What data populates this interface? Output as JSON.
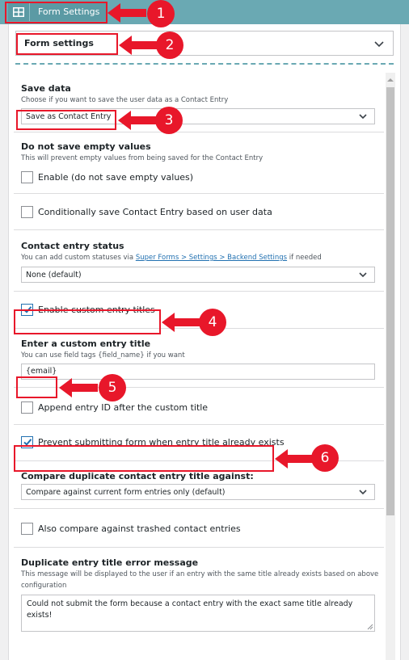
{
  "topbar": {
    "title": "Form Settings",
    "icon": "grid-icon"
  },
  "section_select": {
    "value": "Form settings"
  },
  "save_data": {
    "title": "Save data",
    "desc": "Choose if you want to save the user data as a Contact Entry",
    "value": "Save as Contact Entry"
  },
  "empty_values": {
    "title": "Do not save empty values",
    "desc": "This will prevent empty values from being saved for the Contact Entry",
    "checkbox_label": "Enable (do not save empty values)",
    "checked": false
  },
  "conditional_save": {
    "checkbox_label": "Conditionally save Contact Entry based on user data",
    "checked": false
  },
  "contact_status": {
    "title": "Contact entry status",
    "desc_before": "You can add custom statuses via ",
    "desc_link": "Super Forms > Settings > Backend Settings",
    "desc_after": " if needed",
    "value": "None (default)"
  },
  "custom_titles": {
    "checkbox_label": "Enable custom entry titles",
    "checked": true
  },
  "custom_title": {
    "title": "Enter a custom entry title",
    "desc": "You can use field tags {field_name} if you want",
    "value": "{email}"
  },
  "append_id": {
    "checkbox_label": "Append entry ID after the custom title",
    "checked": false
  },
  "prevent_duplicate": {
    "checkbox_label": "Prevent submitting form when entry title already exists",
    "checked": true
  },
  "compare_against": {
    "title": "Compare duplicate contact entry title against:",
    "value": "Compare against current form entries only (default)"
  },
  "trashed": {
    "checkbox_label": "Also compare against trashed contact entries",
    "checked": false
  },
  "error_message": {
    "title": "Duplicate entry title error message",
    "desc": "This message will be displayed to the user if an entry with the same title already exists based on above configuration",
    "value": "Could not submit the form because a contact entry with the exact same title already exists!"
  },
  "annotations": [
    "1",
    "2",
    "3",
    "4",
    "5",
    "6"
  ],
  "colors": {
    "accent": "#6aa9b3",
    "annotation": "#e8172a",
    "checkbox": "#2271b1"
  }
}
